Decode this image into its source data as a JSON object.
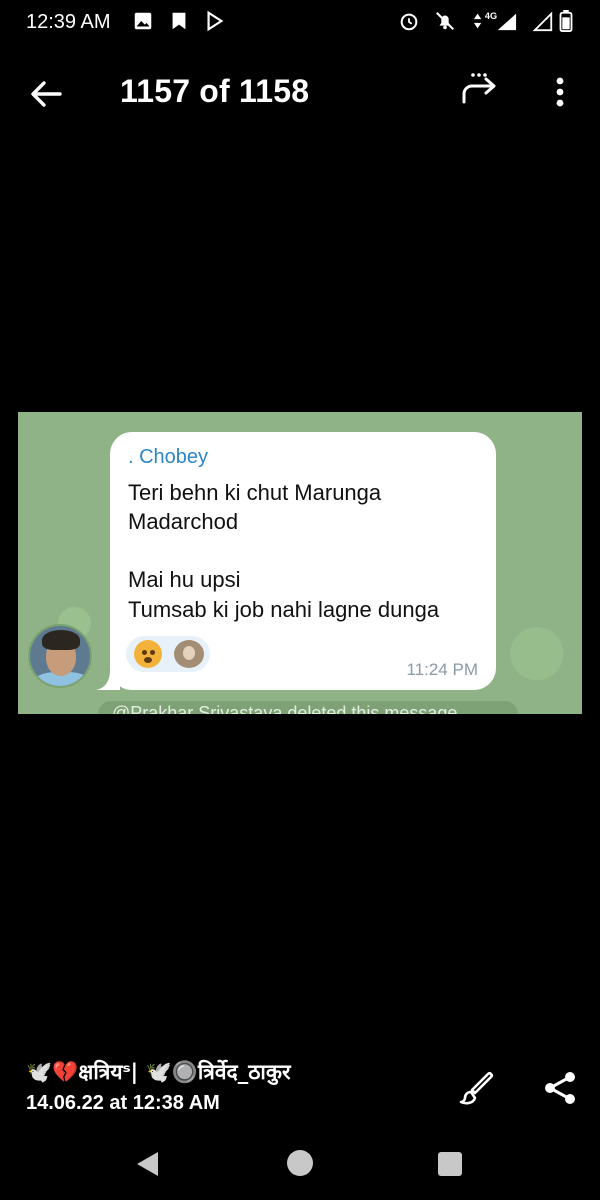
{
  "status_bar": {
    "time": "12:39 AM",
    "network": "4G",
    "left_icons": [
      "gallery-icon",
      "notification-icon",
      "play-store-icon"
    ],
    "right_icons": [
      "alarm-icon",
      "notifications-off-icon",
      "network-4g-icon",
      "signal-icon",
      "no-signal-icon",
      "battery-icon"
    ]
  },
  "toolbar": {
    "counter": "1157 of 1158",
    "back_icon": "arrow-left-icon",
    "forward_icon": "forward-icon",
    "more_icon": "more-vert-icon"
  },
  "message": {
    "sender": ". Chobey",
    "lines": [
      "Teri behn ki chut Marunga",
      "Madarchod",
      "",
      "Mai hu upsi",
      "Tumsab ki job nahi lagne dunga"
    ],
    "time": "11:24 PM",
    "reactions": [
      "exploding-head-emoji",
      "reactor-avatar"
    ],
    "partial_text": "@Prakhar Srivastava deleted this message"
  },
  "footer": {
    "uploader": "🕊️💔क्षत्रियˢ| 🕊️🔘त्रिर्वेद_ठाकुर",
    "date": "14.06.22 at 12:38 AM",
    "edit_icon": "brush-icon",
    "share_icon": "share-icon"
  },
  "navbar": {
    "icons": [
      "nav-back-icon",
      "nav-home-icon",
      "nav-recents-icon"
    ]
  }
}
